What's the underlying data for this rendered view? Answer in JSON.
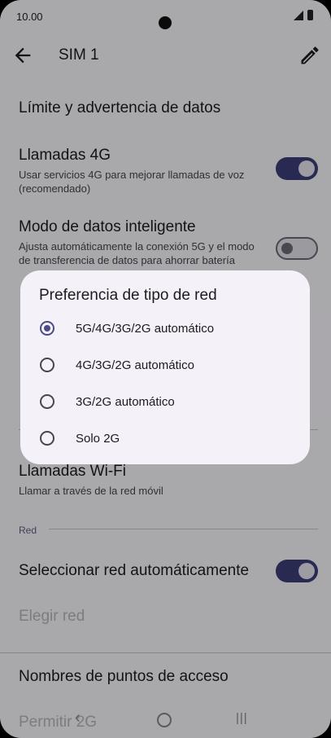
{
  "status_bar": {
    "time": "10.00"
  },
  "app_bar": {
    "title": "SIM 1"
  },
  "settings": {
    "data_limit": {
      "title": "Límite y advertencia de datos"
    },
    "calls_4g": {
      "title": "Llamadas 4G",
      "subtitle": "Usar servicios 4G para mejorar llamadas de voz (recomendado)",
      "enabled": true
    },
    "smart_data": {
      "title": "Modo de datos inteligente",
      "subtitle": "Ajusta automáticamente la conexión 5G y el modo de transferencia de datos para ahorrar batería",
      "enabled": false
    },
    "wifi_calls": {
      "title": "Llamadas Wi-Fi",
      "subtitle": "Llamar a través de la red móvil"
    },
    "network_section": "Red",
    "auto_network": {
      "title": "Seleccionar red automáticamente",
      "enabled": true
    },
    "choose_network": {
      "title": "Elegir red"
    },
    "apn": {
      "title": "Nombres de puntos de acceso"
    },
    "allow_2g": {
      "title": "Permitir 2G"
    }
  },
  "dialog": {
    "title": "Preferencia de tipo de red",
    "options": [
      {
        "label": "5G/4G/3G/2G automático",
        "selected": true
      },
      {
        "label": "4G/3G/2G automático",
        "selected": false
      },
      {
        "label": "3G/2G automático",
        "selected": false
      },
      {
        "label": "Solo 2G",
        "selected": false
      }
    ]
  },
  "colors": {
    "accent": "#3c3f7a",
    "scrim": "rgba(0,0,0,0.32)"
  }
}
